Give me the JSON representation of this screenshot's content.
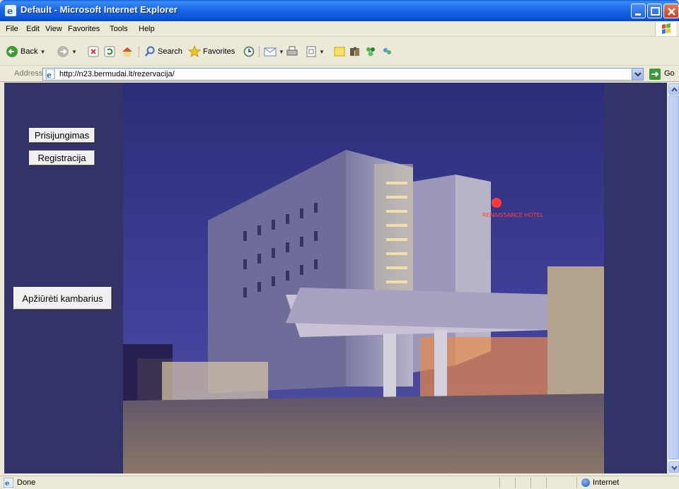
{
  "window": {
    "title": "Default - Microsoft Internet Explorer"
  },
  "menu": {
    "items": [
      "File",
      "Edit",
      "View",
      "Favorites",
      "Tools",
      "Help"
    ]
  },
  "toolbar": {
    "back_label": "Back",
    "search_label": "Search",
    "favorites_label": "Favorites"
  },
  "address": {
    "label": "Address",
    "url": "http://n23.bermudai.lt/rezervacija/",
    "go_label": "Go"
  },
  "page": {
    "login_button": "Prisijungimas",
    "register_button": "Registracija",
    "view_rooms_button": "Apžiūrėti kambarius",
    "hotel_sign": "RENAISSANCE HOTEL"
  },
  "status": {
    "text": "Done",
    "zone": "Internet"
  },
  "colors": {
    "page_background": "#323469",
    "titlebar": "#0b55d6",
    "chrome": "#ece9d8"
  }
}
